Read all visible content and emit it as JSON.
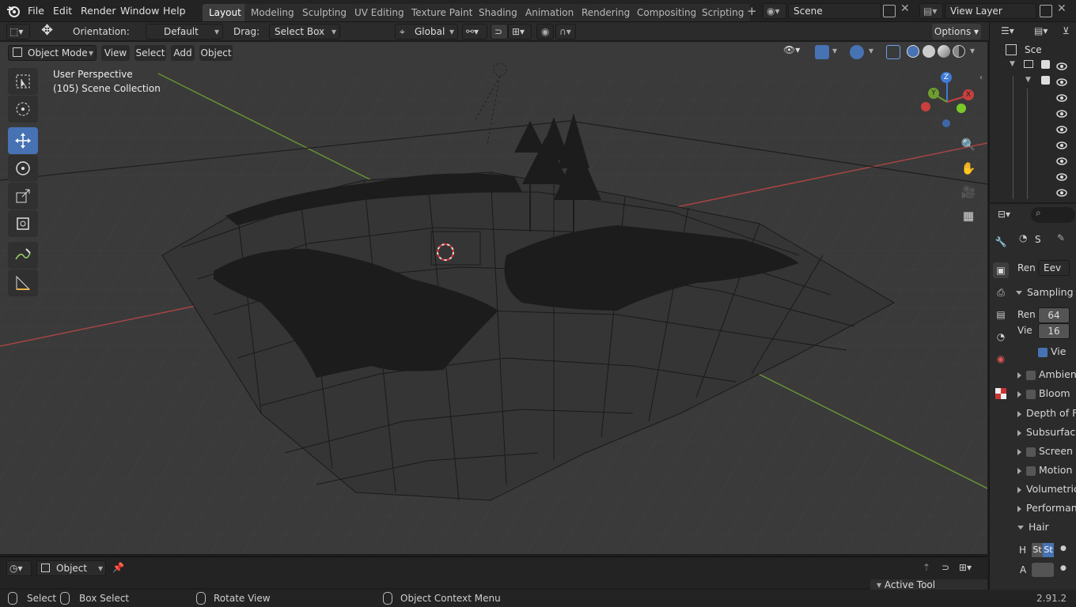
{
  "menu": {
    "items": [
      "File",
      "Edit",
      "Render",
      "Window",
      "Help"
    ]
  },
  "workspaces": {
    "tabs": [
      "Layout",
      "Modeling",
      "Sculpting",
      "UV Editing",
      "Texture Paint",
      "Shading",
      "Animation",
      "Rendering",
      "Compositing",
      "Scripting"
    ],
    "active": "Layout"
  },
  "scene": {
    "name": "Scene",
    "view_layer": "View Layer"
  },
  "tool_header": {
    "orientation_label": "Orientation:",
    "orientation_value": "Default",
    "drag_label": "Drag:",
    "drag_value": "Select Box",
    "transform_space": "Global",
    "options_label": "Options"
  },
  "view_header": {
    "mode": "Object Mode",
    "menus": [
      "View",
      "Select",
      "Add",
      "Object"
    ]
  },
  "viewport": {
    "perspective": "User Perspective",
    "collection": "(105) Scene Collection"
  },
  "gizmo": {
    "x": "X",
    "y": "Y",
    "z": "Z"
  },
  "outliner": {
    "scene_label": "Sce"
  },
  "properties": {
    "tab_label": "S",
    "render_engine_label": "Ren",
    "render_engine_value": "Eev",
    "sampling": {
      "title": "Sampling",
      "render_label": "Ren",
      "render_value": "64",
      "viewport_label": "Vie",
      "viewport_value": "16",
      "denoise_label": "Vie"
    },
    "panels": [
      "Ambien",
      "Bloom",
      "Depth of Fi",
      "Subsurfac",
      "Screen",
      "Motion",
      "Volumetric",
      "Performan",
      "Hair"
    ],
    "hair": {
      "h_label": "H",
      "a_label": "A",
      "strand_a": "St",
      "strand_b": "St"
    }
  },
  "timeline": {
    "editor_mode": "Object",
    "active_tool": "Active Tool"
  },
  "status": {
    "select": "Select",
    "box_select": "Box Select",
    "rotate_view": "Rotate View",
    "context_menu": "Object Context Menu",
    "version": "2.91.2"
  },
  "colors": {
    "accent": "#4772b3",
    "x_axis": "#c9403d",
    "y_axis": "#6f9e2f",
    "z_axis": "#3f7bd6",
    "viewport_bg": "#3a3a3a"
  }
}
